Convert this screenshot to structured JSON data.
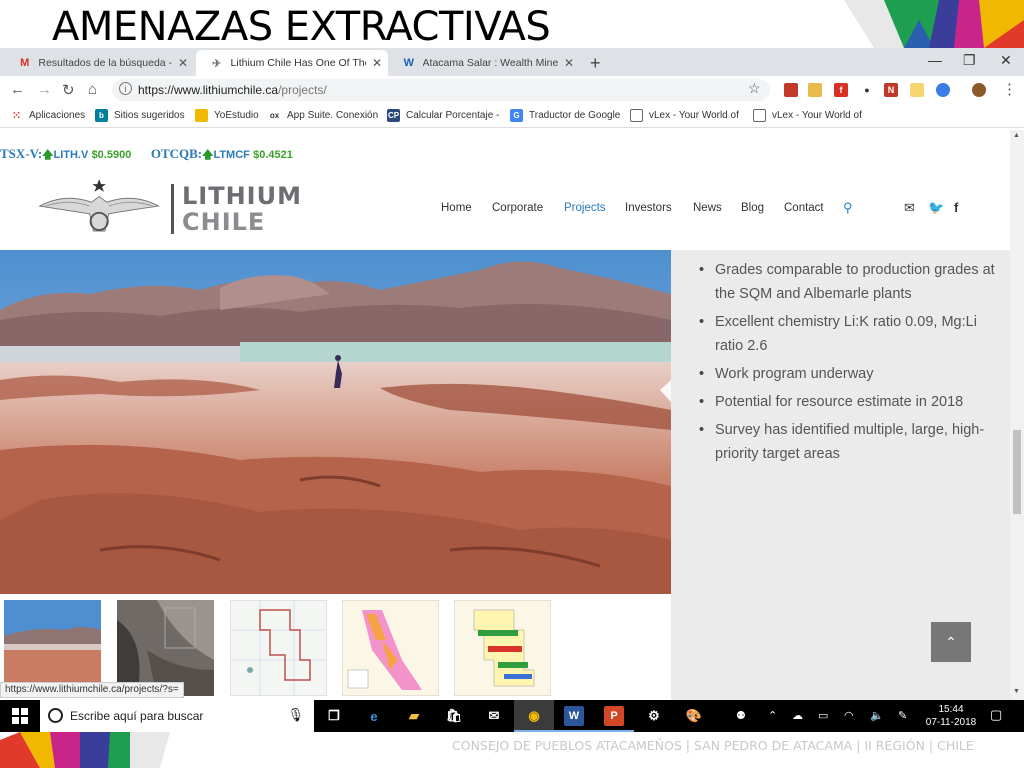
{
  "slide": {
    "title": "AMENAZAS EXTRACTIVAS",
    "footer": "CONSEJO DE PUEBLOS ATACAMEÑOS | SAN PEDRO DE ATACAMA | II REGIÓN | CHILE"
  },
  "browser": {
    "tabs": [
      {
        "label": "Resultados de la búsqueda - juan",
        "icon": "gmail-icon",
        "active": false
      },
      {
        "label": "Lithium Chile Has One Of The La",
        "icon": "lithium-favicon-icon",
        "active": true
      },
      {
        "label": "Atacama Salar : Wealth Minerals",
        "icon": "wealth-minerals-favicon-icon",
        "active": false
      }
    ],
    "url_host": "https://www.lithiumchile.ca",
    "url_path": "/projects/",
    "bookmarks": [
      {
        "label": "Aplicaciones",
        "icon": "apps-grid-icon"
      },
      {
        "label": "Sitios sugeridos",
        "icon": "bing-icon"
      },
      {
        "label": "YoEstudio",
        "icon": "yoestudio-icon"
      },
      {
        "label": "App Suite. Conexión",
        "icon": "ox-icon"
      },
      {
        "label": "Calcular Porcentaje -",
        "icon": "calculator-icon"
      },
      {
        "label": "Traductor de Google",
        "icon": "google-translate-icon"
      },
      {
        "label": "vLex - Your World of",
        "icon": "page-icon"
      },
      {
        "label": "vLex - Your World of",
        "icon": "page-icon"
      }
    ],
    "status_url": "https://www.lithiumchile.ca/projects/?s="
  },
  "website": {
    "ticker": {
      "tsx_label": "TSX-V:",
      "tsx_symbol": "LITH.V",
      "tsx_price": "$0.5900",
      "otc_label": "OTCQB:",
      "otc_symbol": "LTMCF",
      "otc_price": "$0.4521"
    },
    "logo": {
      "line1": "LITHIUM",
      "line2": "CHILE"
    },
    "nav": [
      {
        "label": "Home",
        "active": false
      },
      {
        "label": "Corporate",
        "active": false
      },
      {
        "label": "Projects",
        "active": true
      },
      {
        "label": "Investors",
        "active": false
      },
      {
        "label": "News",
        "active": false
      },
      {
        "label": "Blog",
        "active": false
      },
      {
        "label": "Contact",
        "active": false
      }
    ],
    "bullets": [
      "Grades comparable to production grades at the SQM and Albemarle plants",
      "Excellent chemistry Li:K ratio 0.09, Mg:Li ratio 2.6",
      "Work program underway",
      "Potential for resource estimate in 2018",
      "Survey has identified multiple, large, high-priority target areas"
    ]
  },
  "taskbar": {
    "search_placeholder": "Escribe aquí para buscar",
    "time": "15:44",
    "date": "07-11-2018"
  },
  "colors": {
    "accent_blue": "#2a7ab8",
    "ticker_green": "#3aa02a",
    "sidebar_bg": "#ebebeb"
  }
}
